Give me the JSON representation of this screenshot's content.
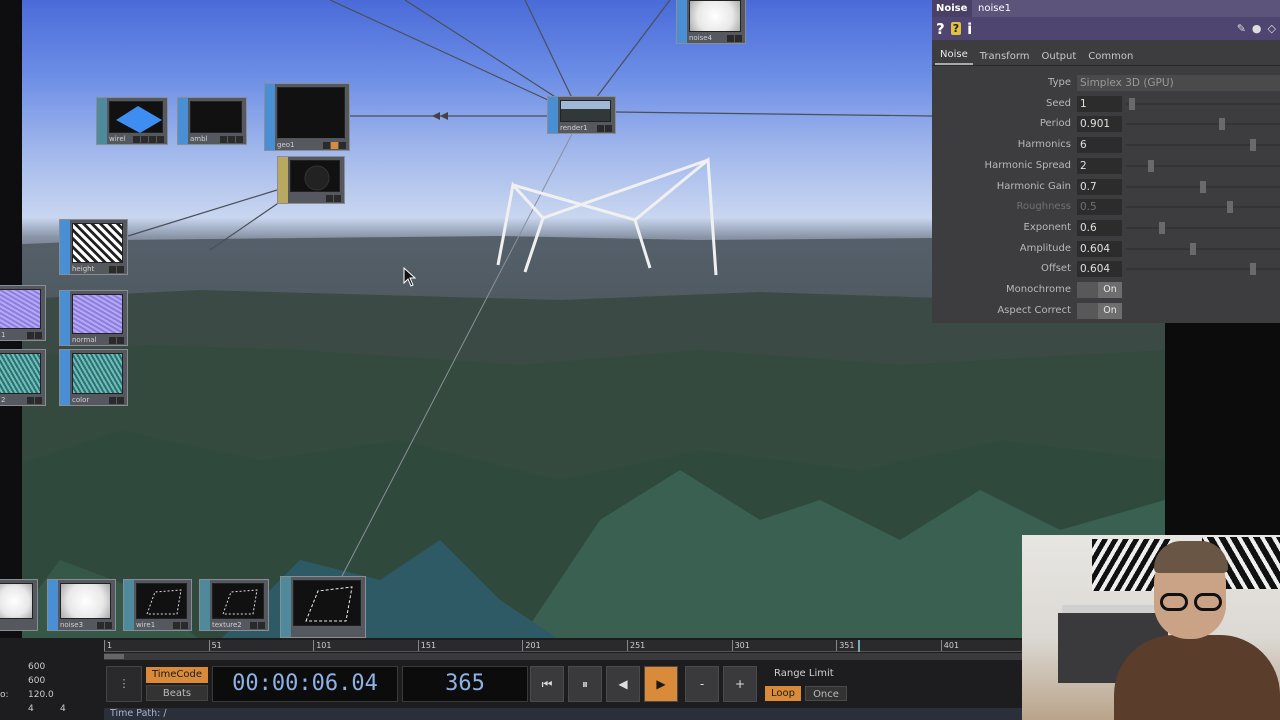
{
  "panel": {
    "op_type": "Noise",
    "op_name": "noise1",
    "tabs": [
      "Noise",
      "Transform",
      "Output",
      "Common"
    ],
    "active_tab": "Noise",
    "params": [
      {
        "label": "Type",
        "value": "Simplex 3D (GPU)",
        "kind": "menu"
      },
      {
        "label": "Seed",
        "value": "1",
        "kind": "slider",
        "level": 0.02
      },
      {
        "label": "Period",
        "value": "0.901",
        "kind": "slider",
        "level": 0.63
      },
      {
        "label": "Harmonics",
        "value": "6",
        "kind": "slider",
        "level": 0.84
      },
      {
        "label": "Harmonic Spread",
        "value": "2",
        "kind": "slider",
        "level": 0.15
      },
      {
        "label": "Harmonic Gain",
        "value": "0.7",
        "kind": "slider",
        "level": 0.5
      },
      {
        "label": "Roughness",
        "value": "0.5",
        "kind": "slider",
        "level": 0.68,
        "disabled": true
      },
      {
        "label": "Exponent",
        "value": "0.6",
        "kind": "slider",
        "level": 0.22
      },
      {
        "label": "Amplitude",
        "value": "0.604",
        "kind": "slider",
        "level": 0.43
      },
      {
        "label": "Offset",
        "value": "0.604",
        "kind": "slider",
        "level": 0.84
      },
      {
        "label": "Monochrome",
        "value": "On",
        "kind": "toggle"
      },
      {
        "label": "Aspect Correct",
        "value": "On",
        "kind": "toggle"
      }
    ]
  },
  "nodes": {
    "noise4": "noise4",
    "render1": "render1",
    "height": "height",
    "normal": "normal",
    "color": "color",
    "noise3": "noise3",
    "wire1": "wire1",
    "texture2": "texture2",
    "row1a": "wirel",
    "row1b": "ambl",
    "row1c": "geo1",
    "left1": "1",
    "left2": "2"
  },
  "timeline": {
    "ruler_ticks": [
      "1",
      "51",
      "101",
      "151",
      "201",
      "251",
      "301",
      "351",
      "401"
    ],
    "left_values": [
      "600",
      "600",
      "120.0",
      "4",
      "4"
    ],
    "left_prefix": "o:",
    "timecode_label": "TimeCode",
    "beats_label": "Beats",
    "time": "00:00:06.04",
    "frame": "365",
    "range_limit_label": "Range Limit",
    "loop_label": "Loop",
    "once_label": "Once",
    "minus": "-",
    "plus": "+",
    "time_path": "Time Path: /"
  }
}
